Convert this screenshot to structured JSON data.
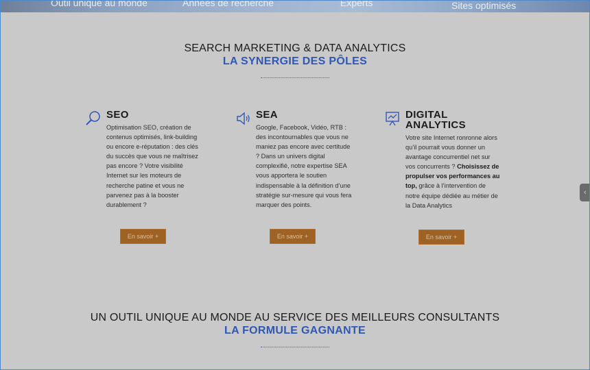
{
  "stats": {
    "items": [
      "Outil unique au monde",
      "Années de recherche",
      "Experts",
      "Sites optimisés"
    ]
  },
  "section1": {
    "title": "SEARCH MARKETING & DATA ANALYTICS",
    "subtitle": "LA SYNERGIE DES PÔLES"
  },
  "columns": [
    {
      "icon": "search-icon",
      "title": "SEO",
      "text": "Optimisation SEO, création de contenus optimisés, link-building ou encore e-réputation : des clés du succès que vous ne maîtrisez pas encore ? Votre visibilité Internet sur les moteurs de recherche patine et vous ne parvenez pas à la booster durablement ?",
      "button": "En savoir +"
    },
    {
      "icon": "speaker-icon",
      "title": "SEA",
      "text": "Google, Facebook, Vidéo, RTB : des incontournables que vous ne maniez pas encore avec certitude ? Dans un univers digital complexifié, notre expertise SEA vous apportera le soutien indispensable à la définition d’une stratégie sur-mesure qui vous fera marquer des points.",
      "button": "En savoir +"
    },
    {
      "icon": "chart-board-icon",
      "title_line1": "DIGITAL",
      "title_line2": "ANALYTICS",
      "text_a": "Votre site Internet ronronne alors qu’il pourrait vous donner un avantage concurrentiel net sur vos concurrents ? ",
      "text_bold": "Choisissez de propulser vos performances au top,",
      "text_b": " grâce à l’intervention de notre équipe dédiée au métier de la Data Analytics",
      "button": "En savoir +"
    }
  ],
  "section2": {
    "title": "UN OUTIL UNIQUE AU MONDE AU SERVICE DES MEILLEURS CONSULTANTS",
    "subtitle": "LA FORMULE GAGNANTE"
  },
  "side_handle": {
    "icon": "chevron-left-icon",
    "glyph": "‹"
  },
  "colors": {
    "accent": "#2f57b5",
    "button": "#9e6224",
    "background": "#c9c9c9"
  }
}
